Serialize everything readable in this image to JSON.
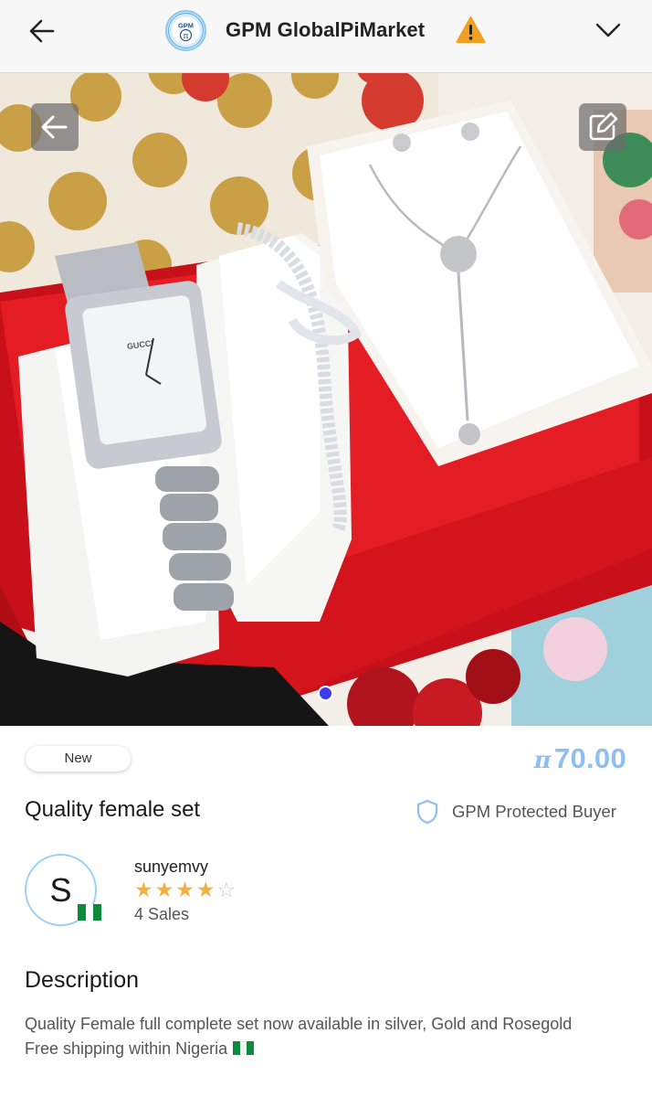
{
  "header": {
    "title": "GPM GlobalPiMarket",
    "logo_text": "GPM",
    "logo_ring_text": "GLOBAL PI MARKET",
    "back_icon": "arrow-left-icon",
    "warning_icon": "warning-triangle-icon",
    "menu_icon": "chevron-down-icon"
  },
  "gallery": {
    "back_icon": "arrow-left-icon",
    "edit_icon": "edit-icon",
    "image_count": 1,
    "active_index": 0,
    "watch_brand": "GUCCI"
  },
  "product": {
    "condition": "New",
    "currency_symbol": "π",
    "price": "70.00",
    "title": "Quality female set",
    "protection_label": "GPM Protected Buyer"
  },
  "seller": {
    "initial": "S",
    "name": "sunyemvy",
    "rating": 4,
    "rating_max": 5,
    "sales_label": "4 Sales",
    "country_flag": "nigeria-flag-icon"
  },
  "description": {
    "heading": "Description",
    "line1": "Quality Female full complete set now available in silver, Gold and Rosegold",
    "line2": "Free shipping within Nigeria"
  },
  "colors": {
    "price": "#8fbff0",
    "star_on": "#f5b043",
    "star_off": "#c9c9c9",
    "warning": "#f0a020",
    "dot": "#3c3ce8",
    "box_red": "#d8141c"
  }
}
